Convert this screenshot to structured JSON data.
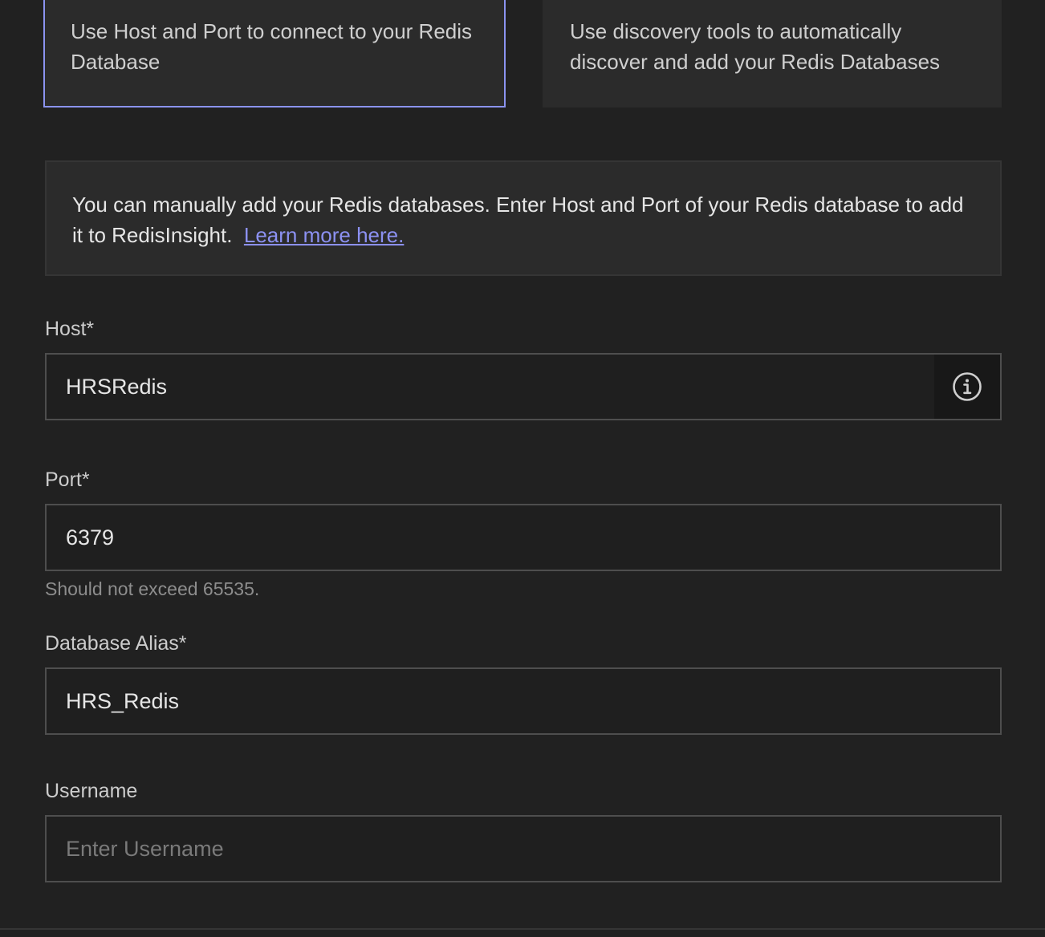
{
  "options": {
    "manual": {
      "text": "Use Host and Port to connect to your Redis Database",
      "selected": true
    },
    "discovery": {
      "text": "Use discovery tools to automatically discover and add your Redis Databases"
    }
  },
  "info": {
    "text": "You can manually add your Redis databases. Enter Host and Port of your Redis database to add it to RedisInsight.",
    "link_text": "Learn more here."
  },
  "form": {
    "host": {
      "label": "Host*",
      "value": "HRSRedis",
      "append_icon": "info-icon"
    },
    "port": {
      "label": "Port*",
      "value": "6379",
      "hint": "Should not exceed 65535."
    },
    "alias": {
      "label": "Database Alias*",
      "value": "HRS_Redis"
    },
    "username": {
      "label": "Username",
      "value": "",
      "placeholder": "Enter Username"
    }
  },
  "colors": {
    "background": "#212121",
    "card": "#2b2b2b",
    "selected_border": "#8b93f0",
    "link": "#8c91f2"
  }
}
